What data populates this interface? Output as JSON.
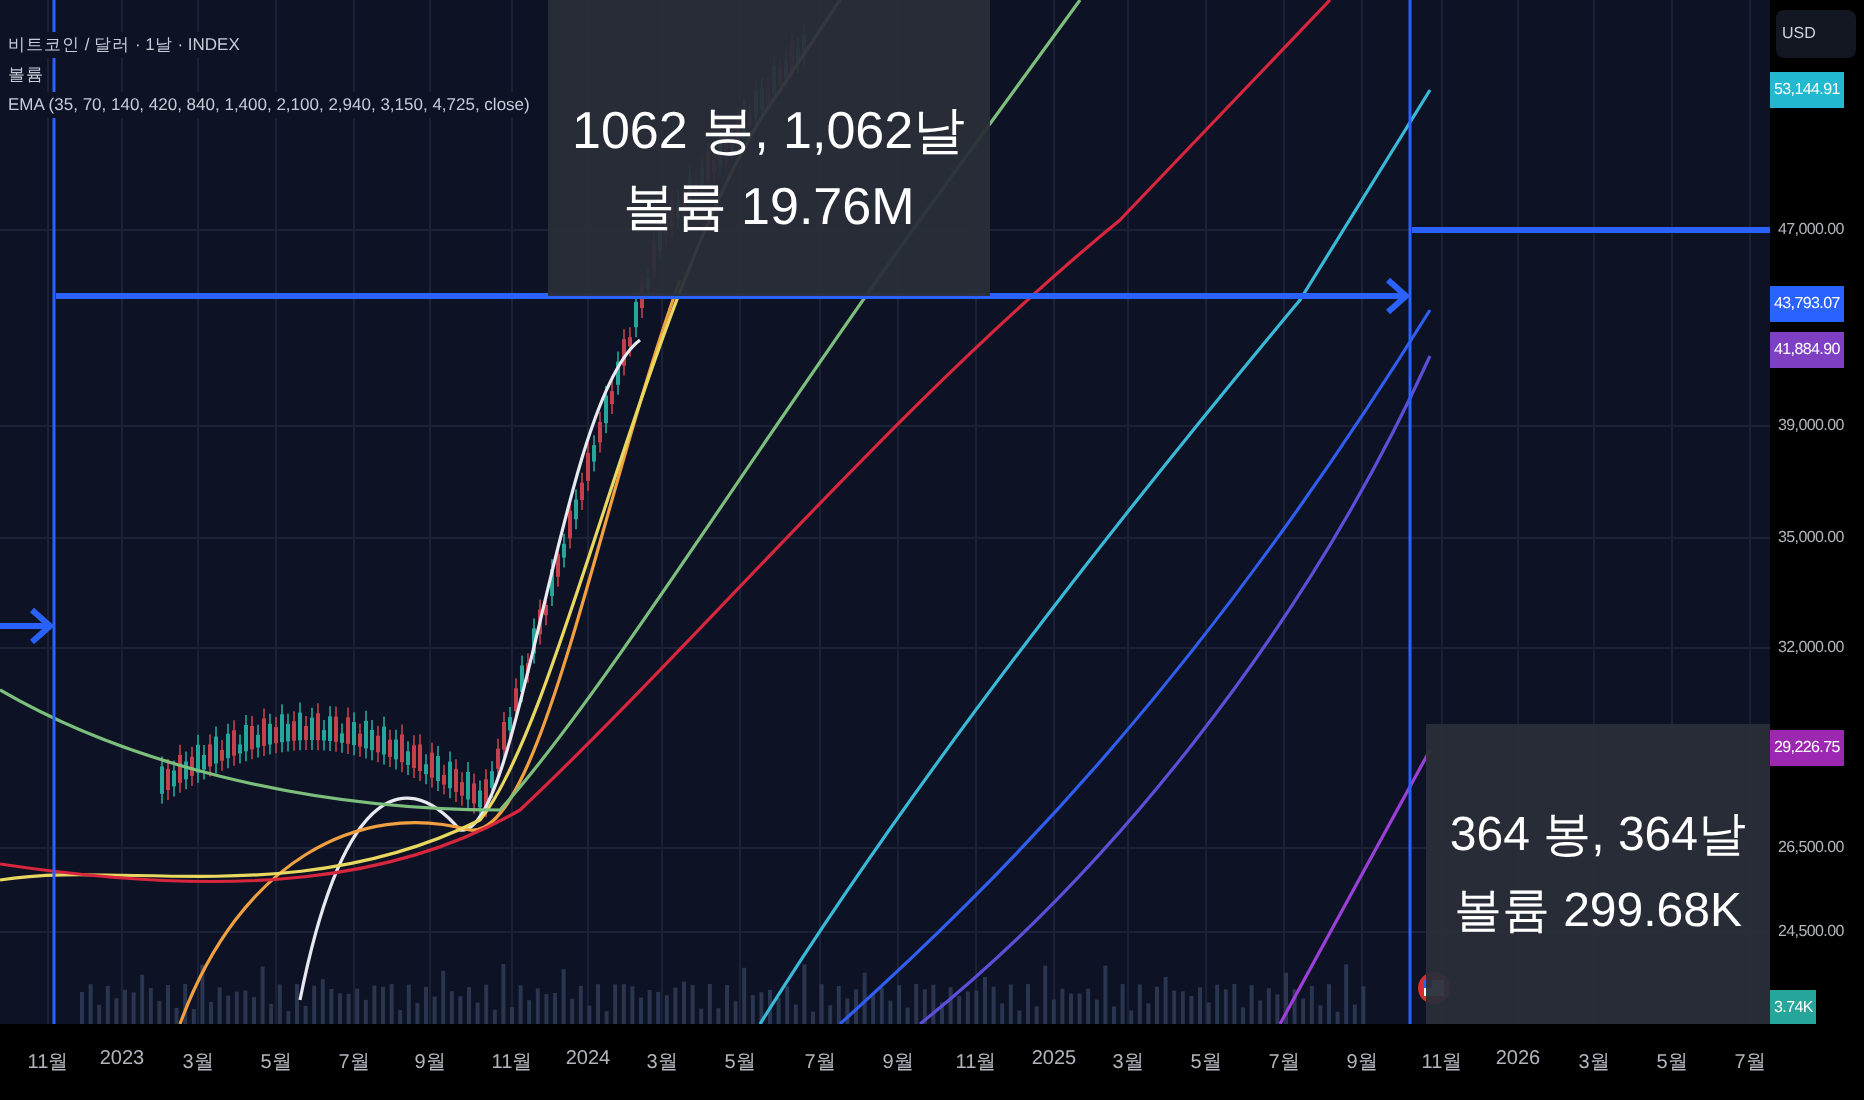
{
  "legend": [
    "비트코인 / 달러 · 1날 · INDEX",
    "볼륨",
    "EMA (35, 70, 140, 420, 840, 1,400, 2,100, 2,940, 3,150, 4,725, close)"
  ],
  "measurements": [
    {
      "bars": "1062 봉, 1,062날",
      "volume": "볼륨 19.76M"
    },
    {
      "bars": "364 봉, 364날",
      "volume": "볼륨 299.68K"
    }
  ],
  "price_axis": {
    "currency": "USD",
    "ticks": [
      "47,000.00",
      "39,000.00",
      "35,000.00",
      "32,000.00",
      "26,500.00",
      "24,500.00"
    ],
    "labels": [
      {
        "text": "53,144.91",
        "color": "#22b8cf"
      },
      {
        "text": "43,793.07",
        "color": "#2962ff"
      },
      {
        "text": "41,884.90",
        "color": "#7e3fc2"
      },
      {
        "text": "29,226.75",
        "color": "#9c27b0"
      },
      {
        "text": "3.74K",
        "color": "#26a69a"
      }
    ]
  },
  "time_axis": [
    "11월",
    "2023",
    "3월",
    "5월",
    "7월",
    "9월",
    "11월",
    "2024",
    "3월",
    "5월",
    "7월",
    "9월",
    "11월",
    "2025",
    "3월",
    "5월",
    "7월",
    "9월",
    "11월",
    "2026",
    "3월",
    "5월",
    "7월"
  ]
}
